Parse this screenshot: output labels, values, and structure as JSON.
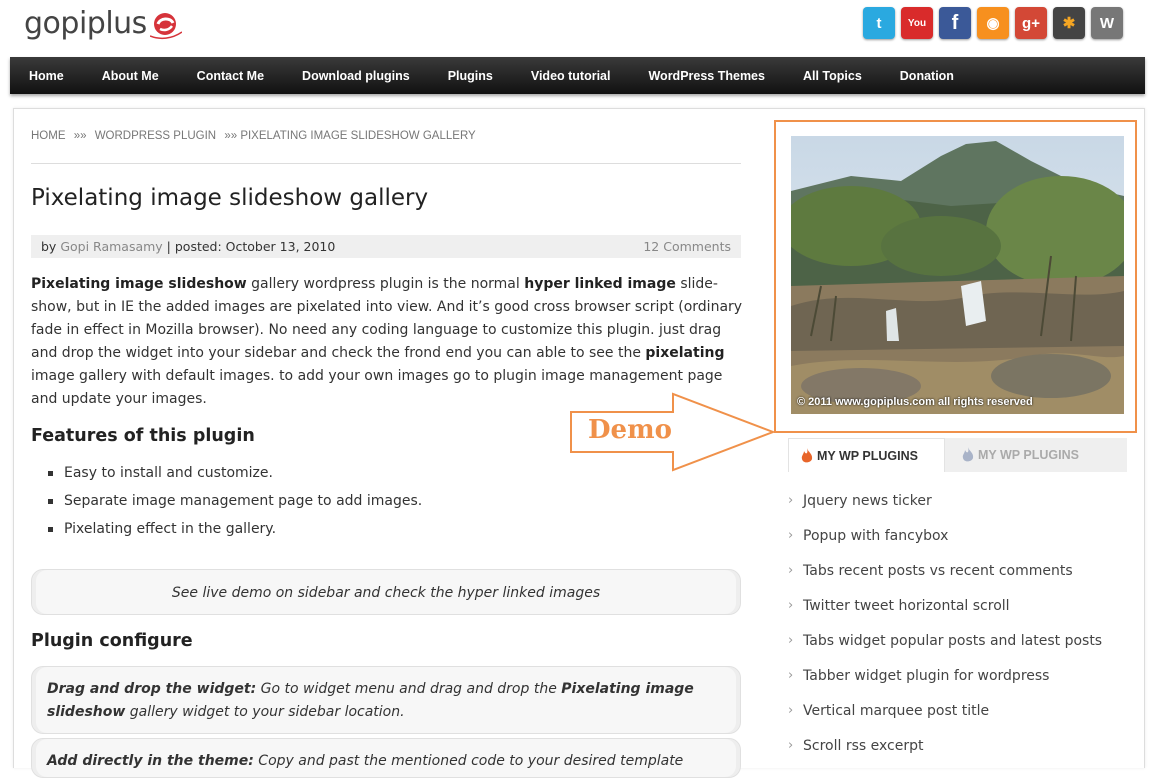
{
  "site": {
    "logo_text": "gopiplus"
  },
  "social": [
    {
      "name": "twitter",
      "glyph": "t",
      "color": "#2aa9e0"
    },
    {
      "name": "youtube",
      "glyph": "You",
      "color": "#d92b2b"
    },
    {
      "name": "facebook",
      "glyph": "f",
      "color": "#3b5998"
    },
    {
      "name": "rss",
      "glyph": "◉",
      "color": "#f7901e"
    },
    {
      "name": "google-plus",
      "glyph": "g+",
      "color": "#d34836"
    },
    {
      "name": "joomla",
      "glyph": "✱",
      "color": "#444"
    },
    {
      "name": "wordpress",
      "glyph": "W",
      "color": "#777"
    }
  ],
  "nav": [
    "Home",
    "About Me",
    "Contact Me",
    "Download plugins",
    "Plugins",
    "Video tutorial",
    "WordPress Themes",
    "All Topics",
    "Donation"
  ],
  "breadcrumb": {
    "home": "HOME",
    "sep": "»»",
    "cat": "WORDPRESS PLUGIN",
    "current": "»» PIXELATING IMAGE SLIDESHOW GALLERY"
  },
  "post": {
    "title": "Pixelating image slideshow gallery",
    "by": "by",
    "author": "Gopi Ramasamy",
    "posted": " | posted: October 13, 2010",
    "comments": "12 Comments",
    "p1_b1": "Pixelating image slideshow",
    "p1_t1": " gallery wordpress plugin is the normal ",
    "p1_b2": "hyper linked image",
    "p1_t2": " slide-show, but in IE the added images are pixelated into view.  And it’s good cross browser script (ordinary fade in effect in Mozilla browser). No need any coding language to customize this plugin. just drag and drop the widget into your sidebar and check the frond end you can able to see the ",
    "p1_b3": "pixelating",
    "p1_t3": " image gallery with default images. to add your own images go to plugin image management page and update your images.",
    "features_heading": "Features of this plugin",
    "features": [
      "Easy to install and customize.",
      "Separate image management page to add images.",
      "Pixelating effect in the gallery."
    ],
    "demo_note": "See live demo on sidebar and check the hyper linked images",
    "configure_heading": "Plugin configure",
    "cfg1_b1": "Drag and drop the widget:",
    "cfg1_t1": " Go to widget menu and drag and drop the ",
    "cfg1_b2": "Pixelating image slideshow",
    "cfg1_t2": " gallery widget to your sidebar location.",
    "cfg2_b1": "Add directly in the theme:",
    "cfg2_t1": " Copy and past the mentioned code to your desired template"
  },
  "sidebar": {
    "copyright": "© 2011 www.gopiplus.com all rights reserved",
    "demo_label": "Demo",
    "tab1": "MY WP PLUGINS",
    "tab2": "MY WP PLUGINS",
    "accent": "#f0914a",
    "plugins": [
      "Jquery news ticker",
      "Popup with fancybox",
      "Tabs recent posts vs recent comments",
      "Twitter tweet horizontal scroll",
      "Tabs widget popular posts and latest posts",
      "Tabber widget plugin for wordpress",
      "Vertical marquee post title",
      "Scroll rss excerpt"
    ]
  }
}
